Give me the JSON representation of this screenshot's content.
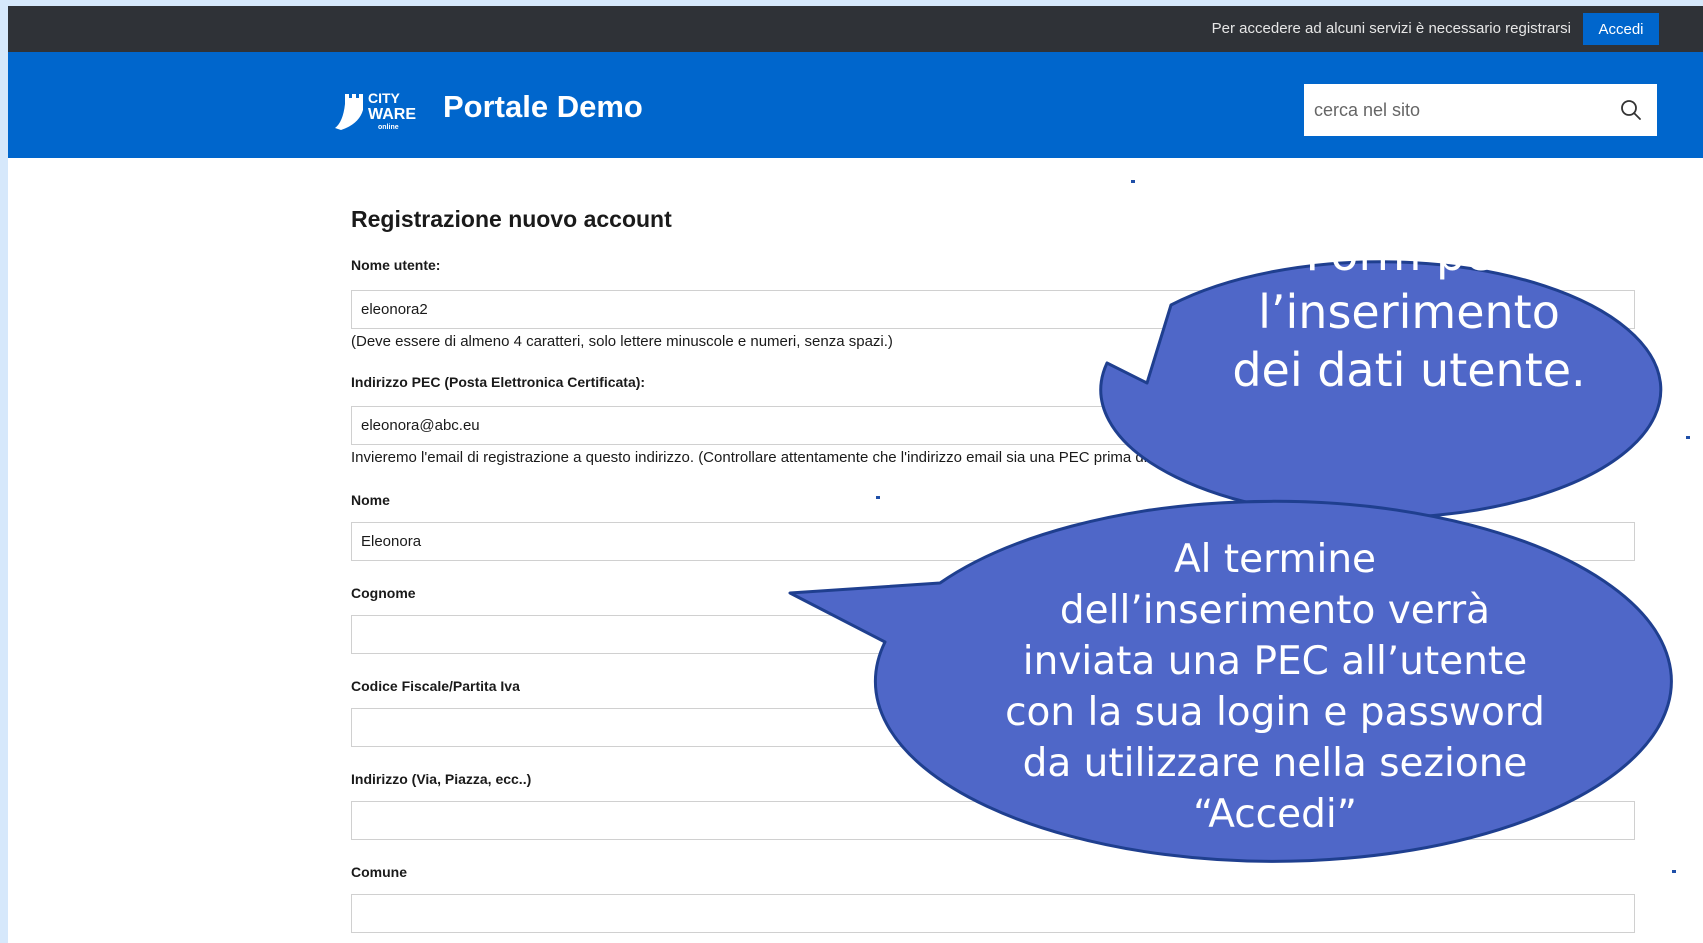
{
  "topbar": {
    "message": "Per accedere ad alcuni servizi è necessario registrarsi",
    "login_button": "Accedi"
  },
  "header": {
    "logo_text": [
      "CITY",
      "WARE",
      "online"
    ],
    "site_title": "Portale Demo",
    "search_placeholder": "cerca nel sito"
  },
  "form": {
    "title": "Registrazione nuovo account",
    "fields": [
      {
        "label": "Nome utente:",
        "value": "eleonora2",
        "help": "(Deve essere di almeno 4 caratteri, solo lettere minuscole e numeri, senza spazi.)"
      },
      {
        "label": "Indirizzo PEC (Posta Elettronica Certificata):",
        "value": "eleonora@abc.eu",
        "help": "Invieremo l'email di registrazione a questo indirizzo. (Controllare attentamente che l'indirizzo email sia una PEC prima di proseguire.)"
      },
      {
        "label": "Nome",
        "value": "Eleonora"
      },
      {
        "label": "Cognome",
        "value": ""
      },
      {
        "label": "Codice Fiscale/Partita Iva",
        "value": ""
      },
      {
        "label": "Indirizzo (Via, Piazza, ecc..)",
        "value": ""
      },
      {
        "label": "Comune",
        "value": ""
      }
    ]
  },
  "callouts": [
    {
      "lines": [
        "Form per",
        "l’inserimento",
        "dei dati utente."
      ]
    },
    {
      "lines": [
        "Al termine",
        "dell’inserimento verrà",
        "inviata una PEC all’utente",
        "con la sua login e password",
        "da utilizzare nella sezione",
        "“Accedi”"
      ]
    }
  ],
  "colors": {
    "topbar": "#2f3237",
    "brand_blue": "#0066cc",
    "callout_fill": "#4f67c8",
    "callout_stroke": "#1f3f8f"
  }
}
